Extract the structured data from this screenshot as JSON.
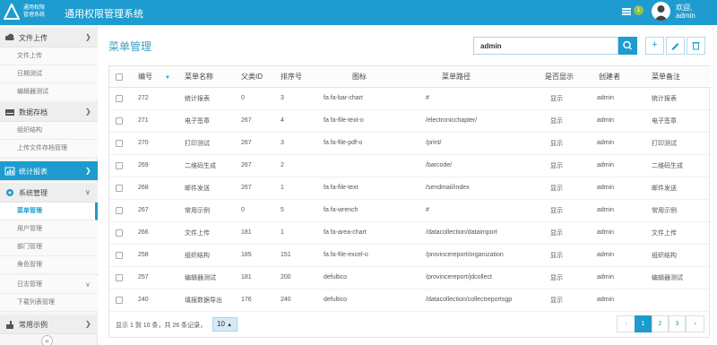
{
  "header": {
    "logo_line1": "通用权限",
    "logo_line2": "管理系统",
    "title": "通用权限管理系统",
    "message_count": "1",
    "welcome": "欢迎,",
    "username": "admin"
  },
  "sidebar": {
    "groups": [
      {
        "label": "文件上传",
        "icon": "cloud-upload-icon",
        "items": [
          "文件上传",
          "日期测试",
          "编辑器测试"
        ]
      },
      {
        "label": "数据存档",
        "icon": "hdd-icon",
        "items": [
          "组织结构",
          "上传文件存档管理"
        ]
      },
      {
        "label": "统计报表",
        "icon": "bar-chart-icon",
        "items": []
      },
      {
        "label": "系统管理",
        "icon": "gear-icon",
        "items": [
          "菜单管理",
          "用户管理",
          "部门管理",
          "角色管理",
          "日志管理",
          "下载列表管理"
        ]
      },
      {
        "label": "常用示例",
        "icon": "hand-icon",
        "items": []
      }
    ],
    "current_item": "菜单管理"
  },
  "main": {
    "title": "菜单管理",
    "search_value": "admin",
    "columns": [
      "编号",
      "菜单名称",
      "父类ID",
      "排序号",
      "图标",
      "菜单路径",
      "是否显示",
      "创建者",
      "菜单备注"
    ],
    "rows": [
      [
        "272",
        "统计报表",
        "0",
        "3",
        "fa fa-bar-chart",
        "#",
        "显示",
        "admin",
        "统计报表"
      ],
      [
        "271",
        "电子签章",
        "267",
        "4",
        "fa fa-file-text-o",
        "/electronicchapter/",
        "显示",
        "admin",
        "电子签章"
      ],
      [
        "270",
        "打印测试",
        "267",
        "3",
        "fa fa-file-pdf-o",
        "/print/",
        "显示",
        "admin",
        "打印测试"
      ],
      [
        "269",
        "二维码生成",
        "267",
        "2",
        "",
        "/barcode/",
        "显示",
        "admin",
        "二维码生成"
      ],
      [
        "268",
        "邮件发送",
        "267",
        "1",
        "fa fa-file-text",
        "/sendmail/index",
        "显示",
        "admin",
        "邮件发送"
      ],
      [
        "267",
        "常用示例",
        "0",
        "5",
        "fa fa-wrench",
        "#",
        "显示",
        "admin",
        "常用示例"
      ],
      [
        "266",
        "文件上传",
        "181",
        "1",
        "fa fa-area-chart",
        "/datacollection/dataimport",
        "显示",
        "admin",
        "文件上传"
      ],
      [
        "258",
        "组织结构",
        "185",
        "151",
        "fa fa-file-excel-o",
        "/provincereport/organization",
        "显示",
        "admin",
        "组织结构"
      ],
      [
        "257",
        "编辑器测试",
        "181",
        "200",
        "defultico",
        "/provincereport/jdcollect",
        "显示",
        "admin",
        "编辑器测试"
      ],
      [
        "240",
        "填报数据导出",
        "176",
        "240",
        "defultico",
        "/datacollection/collectreportsgp",
        "显示",
        "admin",
        ""
      ]
    ],
    "footer_info": "显示 1 到 10 条，共 26 条记录，",
    "page_size": "10",
    "pages": [
      "1",
      "2",
      "3"
    ],
    "current_page": "1"
  },
  "colors": {
    "accent": "#1e9ccf",
    "badge": "#8bc34a"
  }
}
